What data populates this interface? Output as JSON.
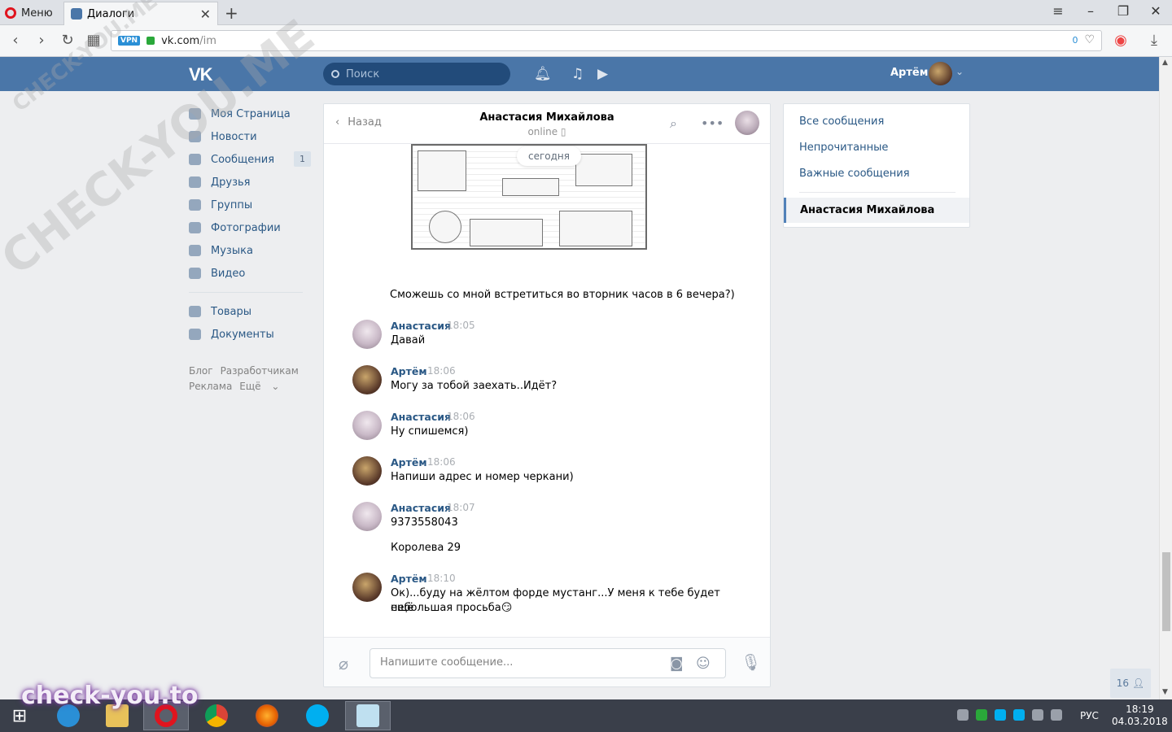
{
  "browser": {
    "menu_label": "Меню",
    "tab_title": "Диалоги",
    "url_host": "vk.com",
    "url_path": "/im",
    "vpn_badge": "VPN",
    "adblock_count": "0"
  },
  "vk": {
    "search_placeholder": "Поиск",
    "user_name": "Артём"
  },
  "left_menu": {
    "items": [
      {
        "label": "Моя Страница"
      },
      {
        "label": "Новости"
      },
      {
        "label": "Сообщения",
        "count": "1"
      },
      {
        "label": "Друзья"
      },
      {
        "label": "Группы"
      },
      {
        "label": "Фотографии"
      },
      {
        "label": "Музыка"
      },
      {
        "label": "Видео"
      }
    ],
    "extra": [
      {
        "label": "Товары"
      },
      {
        "label": "Документы"
      }
    ],
    "footer": [
      "Блог",
      "Разработчикам",
      "Реклама",
      "Ещё"
    ]
  },
  "chat": {
    "back_label": "Назад",
    "title": "Анастасия Михайлова",
    "status": "online",
    "date_divider": "сегодня",
    "continuation_text": "Сможешь со мной встретиться во вторник часов в 6 вечера?)",
    "messages": [
      {
        "author": "Анастасия",
        "time": "18:05",
        "lines": [
          "Давай"
        ]
      },
      {
        "author": "Артём",
        "time": "18:06",
        "lines": [
          "Могу за тобой заехать..Идёт?"
        ]
      },
      {
        "author": "Анастасия",
        "time": "18:06",
        "lines": [
          "Ну спишемся)"
        ]
      },
      {
        "author": "Артём",
        "time": "18:06",
        "lines": [
          "Напиши адрес и номер черкани)"
        ]
      },
      {
        "author": "Анастасия",
        "time": "18:07",
        "lines": [
          "9373558043",
          "Королева 29"
        ]
      },
      {
        "author": "Артём",
        "time": "18:10",
        "lines": [
          "Ок)...буду на жёлтом форде мустанг...У меня к тебе будет ещё",
          "небольшая просьба😏"
        ]
      }
    ],
    "composer_placeholder": "Напишите сообщение..."
  },
  "right_panel": {
    "all": "Все сообщения",
    "unread": "Непрочитанные",
    "important": "Важные сообщения",
    "active_dialog": "Анастасия Михайлова"
  },
  "online_count": "16",
  "taskbar": {
    "lang": "РУС",
    "time": "18:19",
    "date": "04.03.2018"
  },
  "watermark": {
    "site": "check-you.to",
    "diag1": "CHECK-YOU.ME",
    "diag2": "CHECK-YOU.ME"
  },
  "colors": {
    "vk_blue": "#4a76a8",
    "link": "#2a5885",
    "bg": "#edeef0"
  }
}
